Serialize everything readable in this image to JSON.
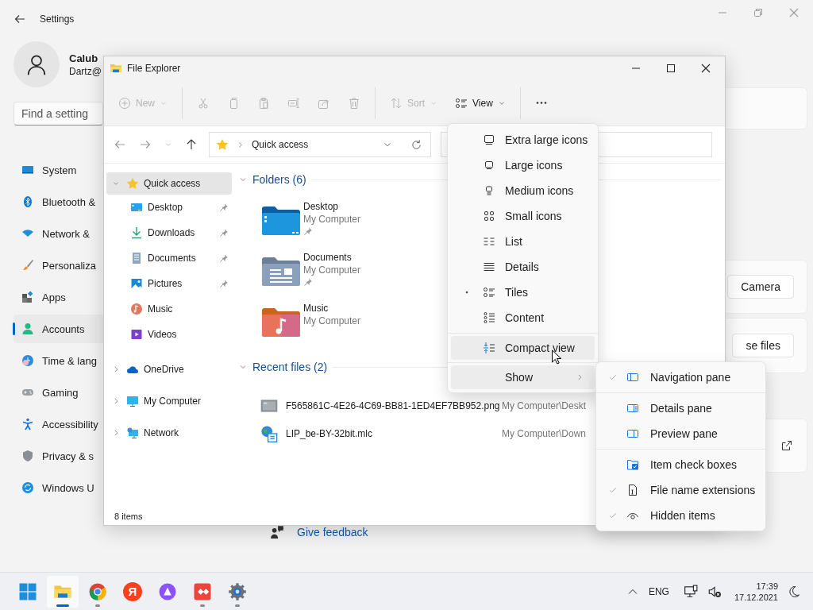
{
  "settings": {
    "title": "Settings",
    "user": {
      "name": "Calub",
      "email": "Dartz@"
    },
    "search": {
      "placeholder": "Find a setting"
    },
    "nav": [
      {
        "label": "System",
        "selected": false
      },
      {
        "label": "Bluetooth &",
        "selected": false
      },
      {
        "label": "Network &",
        "selected": false
      },
      {
        "label": "Personaliza",
        "selected": false
      },
      {
        "label": "Apps",
        "selected": false
      },
      {
        "label": "Accounts",
        "selected": true
      },
      {
        "label": "Time & lang",
        "selected": false
      },
      {
        "label": "Gaming",
        "selected": false
      },
      {
        "label": "Accessibility",
        "selected": false
      },
      {
        "label": "Privacy & s",
        "selected": false
      },
      {
        "label": "Windows U",
        "selected": false
      }
    ],
    "buttons": [
      "Camera",
      "se files"
    ],
    "feedback": "Give feedback"
  },
  "explorer": {
    "title": "File Explorer",
    "toolbar": [
      {
        "label": "New",
        "disabled": true
      },
      {
        "disabled": true
      },
      {
        "disabled": true
      },
      {
        "disabled": true
      },
      {
        "disabled": true
      },
      {
        "disabled": true
      },
      {
        "disabled": true
      },
      {
        "label": "Sort",
        "disabled": true
      },
      {
        "label": "View",
        "disabled": false
      },
      {
        "disabled": false
      }
    ],
    "address": "Quick access",
    "tree": [
      {
        "label": "Quick access",
        "expanded": true,
        "selected": true,
        "children": [
          {
            "label": "Desktop",
            "pinned": true,
            "selected": false
          },
          {
            "label": "Downloads",
            "pinned": true,
            "selected": false
          },
          {
            "label": "Documents",
            "pinned": true,
            "selected": false
          },
          {
            "label": "Pictures",
            "pinned": true,
            "selected": false
          },
          {
            "label": "Music",
            "pinned": false,
            "selected": false
          },
          {
            "label": "Videos",
            "pinned": false,
            "selected": false
          }
        ]
      },
      {
        "label": "OneDrive",
        "expanded": false,
        "selected": false
      },
      {
        "label": "My Computer",
        "expanded": false,
        "selected": false
      },
      {
        "label": "Network",
        "expanded": false,
        "selected": false
      }
    ],
    "folders_header": "Folders (6)",
    "folders": [
      {
        "name": "Desktop",
        "location": "My Computer",
        "pinned": true
      },
      {
        "name": "Documents",
        "location": "My Computer",
        "pinned": true
      },
      {
        "name": "Music",
        "location": "My Computer",
        "pinned": false
      }
    ],
    "recent_header": "Recent files (2)",
    "recent": [
      {
        "name": "F565861C-4E26-4C69-BB81-1ED4EF7BB952.png",
        "location": "My Computer\\Deskt"
      },
      {
        "name": "LIP_be-BY-32bit.mlc",
        "location": "My Computer\\Down"
      }
    ],
    "status": "8 items"
  },
  "view_menu": {
    "layouts": [
      {
        "label": "Extra large icons",
        "selected": false
      },
      {
        "label": "Large icons",
        "selected": false
      },
      {
        "label": "Medium icons",
        "selected": false
      },
      {
        "label": "Small icons",
        "selected": false
      },
      {
        "label": "List",
        "selected": false
      },
      {
        "label": "Details",
        "selected": false
      },
      {
        "label": "Tiles",
        "selected": true
      },
      {
        "label": "Content",
        "selected": false
      }
    ],
    "compact_view": {
      "label": "Compact view",
      "checked": false,
      "highlighted": true
    },
    "show": {
      "label": "Show",
      "expanded": true
    }
  },
  "show_menu": {
    "groups": [
      [
        {
          "label": "Navigation pane",
          "checked": true
        }
      ],
      [
        {
          "label": "Details pane",
          "checked": false
        },
        {
          "label": "Preview pane",
          "checked": false
        }
      ],
      [
        {
          "label": "Item check boxes",
          "checked": false
        },
        {
          "label": "File name extensions",
          "checked": true
        },
        {
          "label": "Hidden items",
          "checked": true
        }
      ]
    ]
  },
  "taskbar": {
    "apps": [
      {
        "active": false,
        "running": false
      },
      {
        "active": true,
        "running": true
      },
      {
        "active": false,
        "running": true
      },
      {
        "label": "Я",
        "active": false,
        "running": false
      },
      {
        "active": false,
        "running": false
      },
      {
        "active": false,
        "running": true
      },
      {
        "active": false,
        "running": true
      }
    ],
    "language": "ENG",
    "time": "17:39",
    "date": "17.12.2021"
  }
}
